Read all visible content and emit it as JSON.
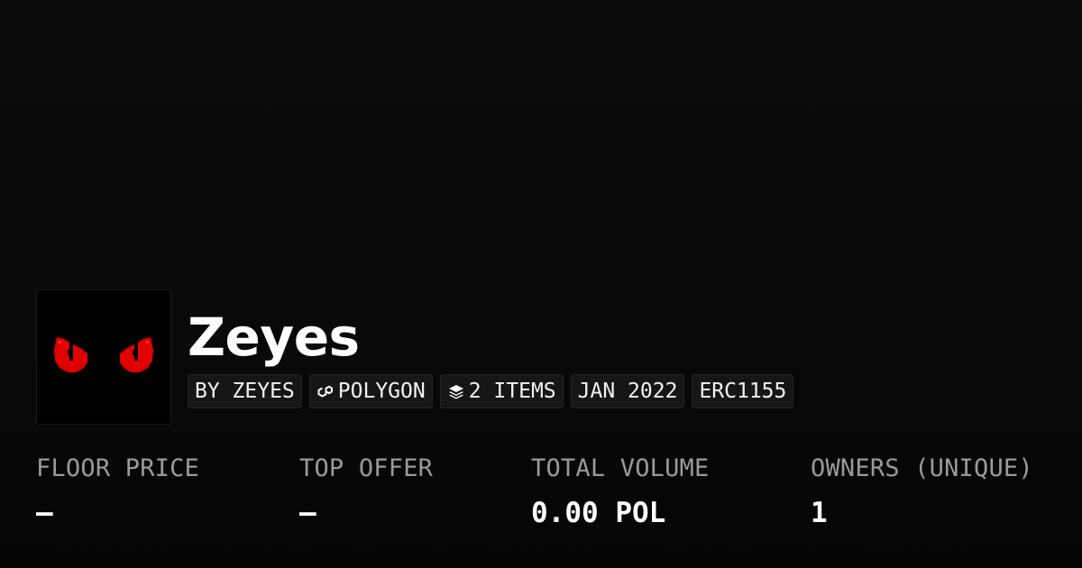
{
  "collection": {
    "name": "Zeyes",
    "avatar_icon": "red-cat-eyes-icon",
    "accent_color": "#e00000"
  },
  "chips": [
    {
      "label": "BY ZEYES",
      "icon": null
    },
    {
      "label": "POLYGON",
      "icon": "polygon-chain-icon"
    },
    {
      "label": "2 ITEMS",
      "icon": "layers-icon"
    },
    {
      "label": "JAN 2022",
      "icon": null
    },
    {
      "label": "ERC1155",
      "icon": null
    }
  ],
  "stats": [
    {
      "label": "FLOOR PRICE",
      "value": "–"
    },
    {
      "label": "TOP OFFER",
      "value": "–"
    },
    {
      "label": "TOTAL VOLUME",
      "value": "0.00 POL"
    },
    {
      "label": "OWNERS (UNIQUE)",
      "value": "1"
    }
  ]
}
